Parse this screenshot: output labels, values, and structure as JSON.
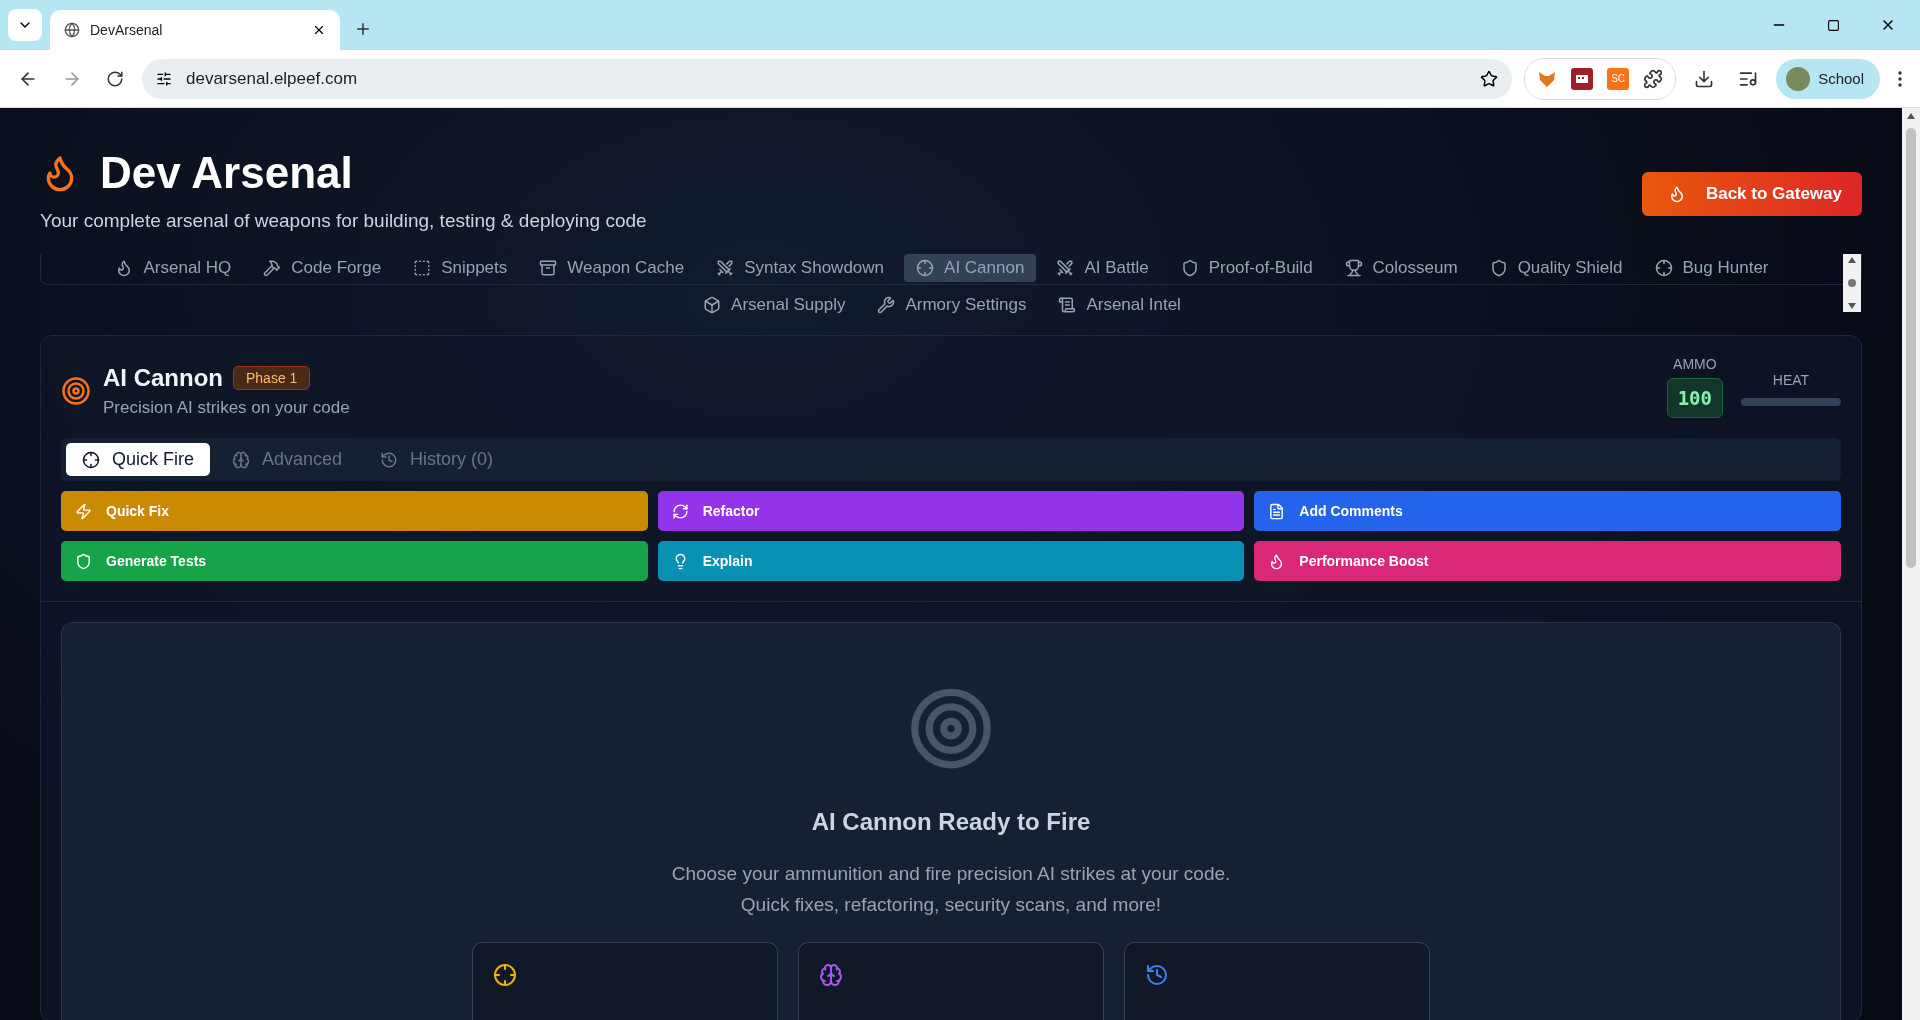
{
  "browser": {
    "tab_title": "DevArsenal",
    "url": "devarsenal.elpeef.com",
    "profile": "School",
    "extension_label": "SC"
  },
  "header": {
    "title": "Dev Arsenal",
    "subtitle": "Your complete arsenal of weapons for building, testing & deploying code",
    "back_button": "Back to Gateway"
  },
  "nav": [
    {
      "label": "Arsenal HQ",
      "selected": false
    },
    {
      "label": "Code Forge",
      "selected": false
    },
    {
      "label": "Snippets",
      "selected": false
    },
    {
      "label": "Weapon Cache",
      "selected": false
    },
    {
      "label": "Syntax Showdown",
      "selected": false
    },
    {
      "label": "AI Cannon",
      "selected": true
    },
    {
      "label": "AI Battle",
      "selected": false
    },
    {
      "label": "Proof-of-Build",
      "selected": false
    },
    {
      "label": "Colosseum",
      "selected": false
    },
    {
      "label": "Quality Shield",
      "selected": false
    },
    {
      "label": "Bug Hunter",
      "selected": false
    },
    {
      "label": "Arsenal Supply",
      "selected": false
    },
    {
      "label": "Armory Settings",
      "selected": false
    },
    {
      "label": "Arsenal Intel",
      "selected": false
    }
  ],
  "card": {
    "title": "AI Cannon",
    "badge": "Phase 1",
    "subtitle": "Precision AI strikes on your code",
    "ammo_label": "AMMO",
    "ammo": "100",
    "heat_label": "HEAT",
    "tabs": [
      {
        "label": "Quick Fire",
        "selected": true
      },
      {
        "label": "Advanced",
        "selected": false
      },
      {
        "label": "History (0)",
        "selected": false
      }
    ],
    "actions": [
      {
        "label": "Quick Fix",
        "color": "#ca8a04"
      },
      {
        "label": "Refactor",
        "color": "#9333ea"
      },
      {
        "label": "Add Comments",
        "color": "#2563eb"
      },
      {
        "label": "Generate Tests",
        "color": "#16a34a"
      },
      {
        "label": "Explain",
        "color": "#0891b2"
      },
      {
        "label": "Performance Boost",
        "color": "#db2777"
      }
    ],
    "empty": {
      "title": "AI Cannon Ready to Fire",
      "lines": [
        "Choose your ammunition and fire precision AI strikes at your code.",
        "Quick fixes, refactoring, security scans, and more!"
      ]
    }
  }
}
